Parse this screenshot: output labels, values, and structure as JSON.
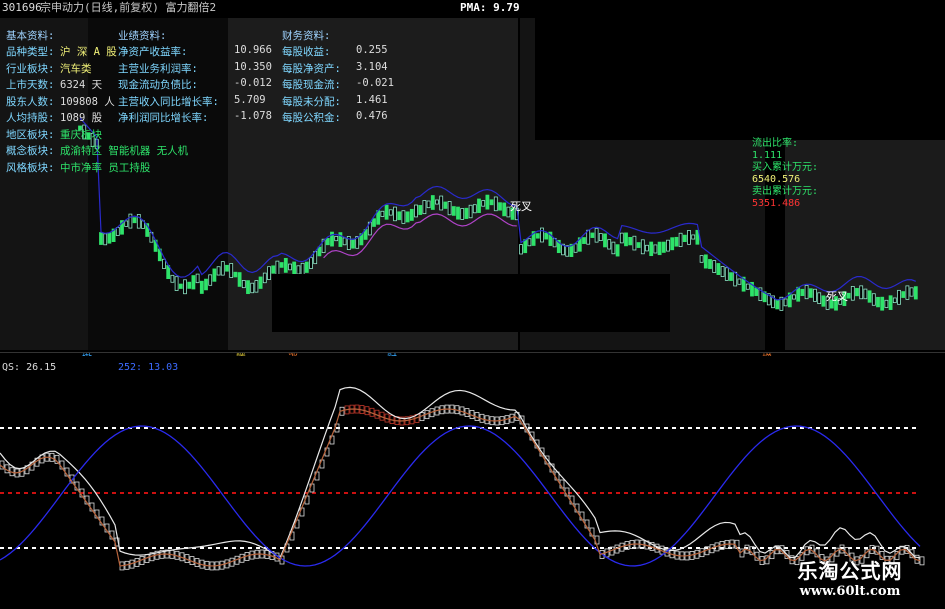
{
  "header": {
    "code": "301696",
    "title": "宗申动力(日线,前复权) 富力翻倍2",
    "pma": "PMA: 9.79"
  },
  "info": {
    "section_basic": "基本资料:",
    "section_perf": "业绩资料:",
    "section_fin": "财务资料:",
    "basic": [
      {
        "label": "品种类型:",
        "value": "沪 深 A 股"
      },
      {
        "label": "行业板块:",
        "value": "汽车类"
      },
      {
        "label": "上市天数:",
        "value": "6324",
        "suffix": "天"
      },
      {
        "label": "股东人数:",
        "value": "109808",
        "suffix": "人"
      },
      {
        "label": "人均持股:",
        "value": "1089",
        "suffix": "股"
      },
      {
        "label": "地区板块:",
        "value": "重庆板块"
      },
      {
        "label": "概念板块:",
        "value": "成渝特区 智能机器 无人机"
      },
      {
        "label": "风格板块:",
        "value": "中市净率 员工持股"
      }
    ],
    "perf": [
      {
        "label": "净资产收益率:",
        "value": "10.966"
      },
      {
        "label": "主营业务利润率:",
        "value": "10.350"
      },
      {
        "label": "现金流动负债比:",
        "value": "-0.012"
      },
      {
        "label": "主营收入同比增长率:",
        "value": "5.709"
      },
      {
        "label": "净利润同比增长率:",
        "value": "-1.078"
      }
    ],
    "fin": [
      {
        "label": "每股收益:",
        "value": "0.255"
      },
      {
        "label": "每股净资产:",
        "value": "3.104"
      },
      {
        "label": "每股现金流:",
        "value": "-0.021"
      },
      {
        "label": "每股未分配:",
        "value": "1.461"
      },
      {
        "label": "每股公积金:",
        "value": "0.476"
      }
    ]
  },
  "right_legend": {
    "ratio_label": "流出比率:",
    "ratio": "1.111",
    "buy_label": "买入累计万元:",
    "buy": "6540.576",
    "sell_label": "卖出累计万元:",
    "sell": "5351.486"
  },
  "signals": {
    "dead_cross_1": "死叉",
    "dead_cross_2": "死叉"
  },
  "events": {
    "e1": "撤",
    "e2": "腾",
    "e3": "涨",
    "e4": "财",
    "e5": "增"
  },
  "indicator": {
    "label": "QS: 26.15",
    "label2": "252: 13.03"
  },
  "watermark": {
    "title": "乐淘公式网",
    "url": "www.60lt.com"
  },
  "colors": {
    "up": "#2ee36a",
    "down": "#2ee36a",
    "ma_blue": "#2a2acc",
    "ma_purple": "#b043c8",
    "dotted_white": "#ffffff",
    "dotted_red": "#cc1010"
  }
}
